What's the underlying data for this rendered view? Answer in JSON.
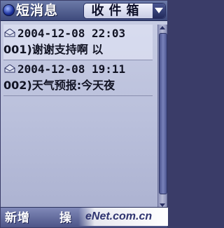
{
  "header": {
    "title": "短消息",
    "folder": "收件箱"
  },
  "messages": [
    {
      "datetime": "2004-12-08 22:03",
      "preview": "001)谢谢支持啊  以",
      "read": true
    },
    {
      "datetime": "2004-12-08 19:11",
      "preview": "002)天气预报:今天夜",
      "read": true
    }
  ],
  "softkeys": {
    "left": "新增",
    "middle": "操"
  },
  "watermark": "eNet.com.cn",
  "icons": {
    "app": "message-app-icon",
    "folder_dropdown": "chevron-down-icon",
    "message": "envelope-open-icon"
  }
}
